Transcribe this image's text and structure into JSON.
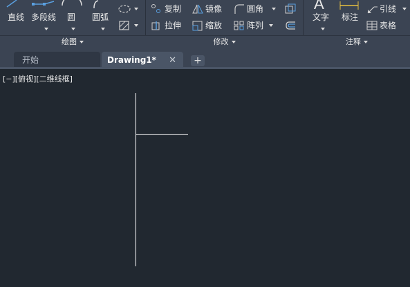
{
  "ribbon": {
    "draw_tools": {
      "line": "直线",
      "polyline": "多段线",
      "circle": "圆",
      "arc": "圆弧"
    },
    "modify_tools": {
      "copy": "复制",
      "mirror": "镜像",
      "fillet": "圆角",
      "stretch": "拉伸",
      "scale": "缩放",
      "array": "阵列"
    },
    "annotation_tools": {
      "text": "文字",
      "dimension": "标注",
      "leader": "引线",
      "table": "表格"
    },
    "panels": {
      "draw": "绘图",
      "modify": "修改",
      "annotation": "注释"
    }
  },
  "tabs": {
    "start": "开始",
    "drawing": "Drawing1*",
    "close_glyph": "✕",
    "add_glyph": "+"
  },
  "viewport": {
    "label": "[−][俯视][二维线框]"
  },
  "colors": {
    "ribbon_bg": "#3b4453",
    "canvas_bg": "#212830",
    "accent_icon": "#5aa0e0",
    "drawing_lines": "#ffffff"
  }
}
